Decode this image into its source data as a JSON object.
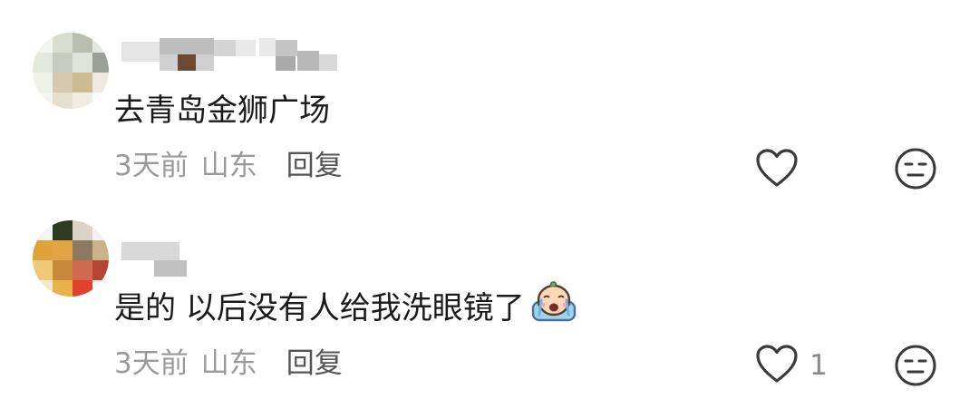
{
  "comments": [
    {
      "content": "去青岛金狮广场",
      "time": "3天前",
      "location": "山东",
      "reply_label": "回复",
      "like_count": "",
      "avatar_colors": [
        "#f3f5ef",
        "#d8ddd0",
        "#b9bdb0",
        "#e3e8df",
        "#c8ccc0",
        "#9aa098",
        "#d6c9b0",
        "#cdbb92",
        "#efeae0"
      ],
      "username_blocks": [
        "#e4e4e4",
        "#bdbdbd",
        "#6b4a33",
        "#d0d0d0",
        "#e9e9e9",
        "#c4c4c4",
        "#aaaaaa"
      ]
    },
    {
      "content": "是的 以后没有人给我洗眼镜了",
      "emoji": "crying-face-emoji",
      "time": "3天前",
      "location": "山东",
      "reply_label": "回复",
      "like_count": "1",
      "avatar_colors": [
        "#2d3a22",
        "#e0a33c",
        "#8a7a60",
        "#e3a445",
        "#c8893b",
        "#d06a50",
        "#efc878",
        "#b84436",
        "#e04030"
      ],
      "username_blocks": [
        "#d8d8d8",
        "#c0c0c0"
      ]
    }
  ],
  "icons": {
    "like": "heart-outline-icon",
    "dislike": "meh-face-icon"
  },
  "colors": {
    "text_primary": "#1a1a1a",
    "text_secondary": "#9a9a9a",
    "reply": "#555555",
    "icon": "#3a3a3a"
  }
}
